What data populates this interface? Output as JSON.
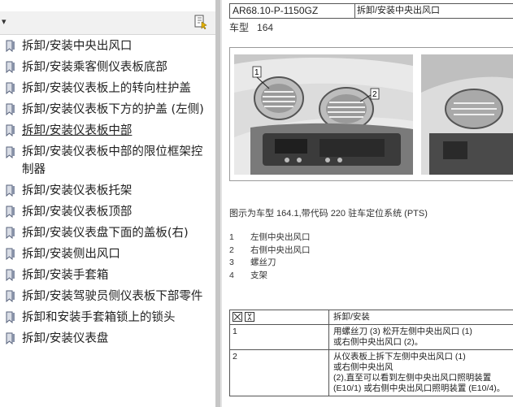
{
  "left_panel": {
    "bookmarks": [
      {
        "label": "拆卸/安装中央出风口"
      },
      {
        "label": "拆卸/安装乘客侧仪表板底部"
      },
      {
        "label": "拆卸/安装仪表板上的转向柱护盖"
      },
      {
        "label": "拆卸/安装仪表板下方的护盖 (左侧)"
      },
      {
        "label": "拆卸/安装仪表板中部"
      },
      {
        "label_line1": "拆卸/安装仪表板中部的限位框架控",
        "label_line2": "制器"
      },
      {
        "label": "拆卸/安装仪表板托架"
      },
      {
        "label": "拆卸/安装仪表板顶部"
      },
      {
        "label": "拆卸/安装仪表盘下面的盖板(右)"
      },
      {
        "label": "拆卸/安装侧出风口"
      },
      {
        "label": "拆卸/安装手套箱"
      },
      {
        "label": "拆卸/安装驾驶员侧仪表板下部零件"
      },
      {
        "label": "拆卸和安装手套箱锁上的锁头"
      },
      {
        "label": "拆卸/安装仪表盘"
      }
    ]
  },
  "document": {
    "code": "AR68.10-P-1150GZ",
    "title": "拆卸/安装中央出风口",
    "model_label": "车型",
    "model_value": "164",
    "figure_callouts": [
      "1",
      "2"
    ],
    "caption": "图示为车型 164.1,带代码 220 驻车定位系统 (PTS)",
    "legend": [
      {
        "num": "1",
        "text": "左侧中央出风口"
      },
      {
        "num": "2",
        "text": "右侧中央出风口"
      },
      {
        "num": "3",
        "text": "螺丝刀"
      },
      {
        "num": "4",
        "text": "支架"
      }
    ],
    "steps_header": "拆卸/安装",
    "steps": [
      {
        "num": "1",
        "lines": [
          "用螺丝刀 (3) 松开左侧中央出风口 (1)",
          "或右侧中央出风口 (2)。"
        ]
      },
      {
        "num": "2",
        "lines": [
          "从仪表板上拆下左侧中央出风口 (1)",
          "或右侧中央出风",
          "(2),直至可以看到左侧中央出风口照明装置",
          "(E10/1) 或右侧中央出风口照明装置 (E10/4)。"
        ]
      }
    ]
  }
}
